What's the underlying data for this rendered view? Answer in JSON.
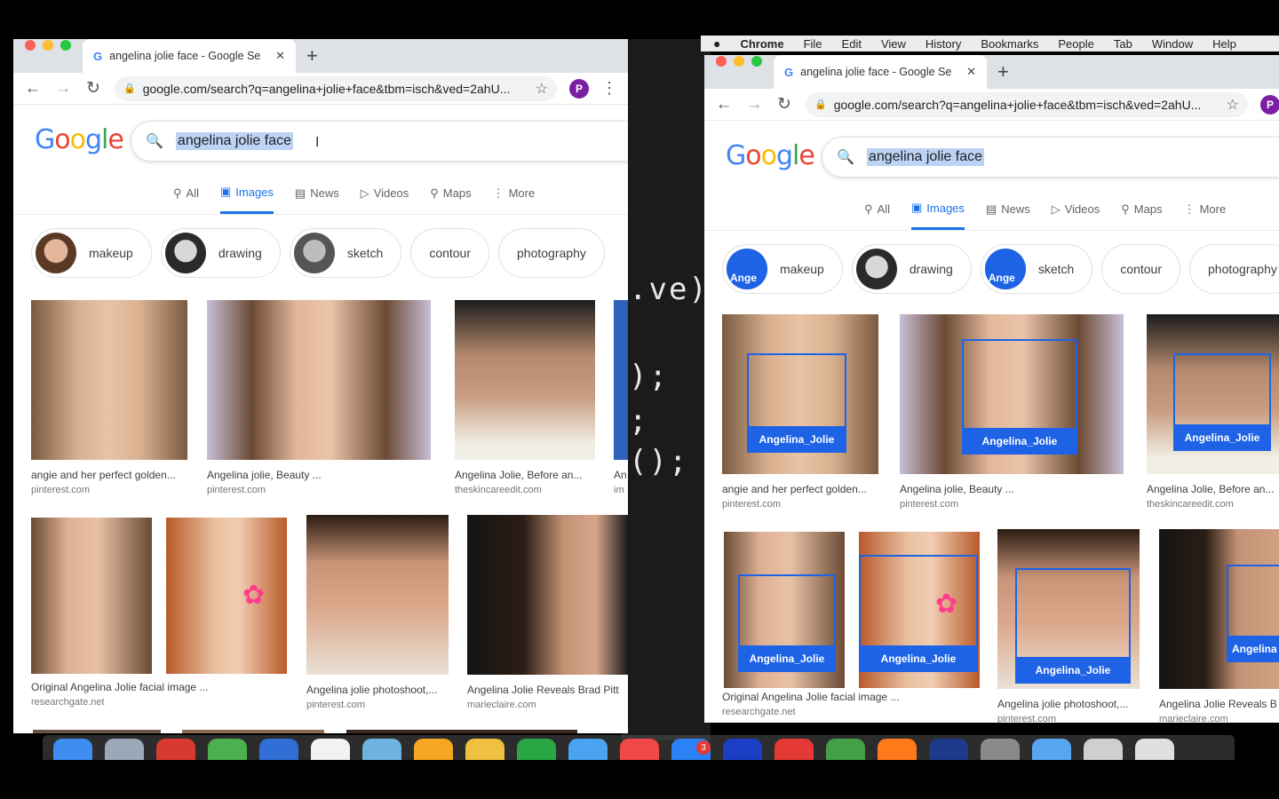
{
  "mac_menubar": {
    "items": [
      "Chrome",
      "File",
      "Edit",
      "View",
      "History",
      "Bookmarks",
      "People",
      "Tab",
      "Window",
      "Help"
    ]
  },
  "editor": {
    "lines": [
      ".ve)",
      ");",
      ";",
      "();"
    ]
  },
  "left": {
    "tab_title": "angelina jolie face - Google Se",
    "url": "google.com/search?q=angelina+jolie+face&tbm=isch&ved=2ahU...",
    "avatar_letter": "P",
    "query": "angelina jolie face",
    "nav_tabs": [
      {
        "label": "All",
        "icon": "search-icon"
      },
      {
        "label": "Images",
        "icon": "image-icon"
      },
      {
        "label": "News",
        "icon": "news-icon"
      },
      {
        "label": "Videos",
        "icon": "video-icon"
      },
      {
        "label": "Maps",
        "icon": "map-pin-icon"
      },
      {
        "label": "More",
        "icon": "more-icon"
      }
    ],
    "chips": [
      "makeup",
      "drawing",
      "sketch",
      "contour",
      "photography"
    ],
    "results": [
      {
        "caption": "angie and her perfect golden...",
        "source": "pinterest.com"
      },
      {
        "caption": "Angelina jolie, Beauty ...",
        "source": "pinterest.com"
      },
      {
        "caption": "Angelina Jolie, Before an...",
        "source": "theskincareedit.com"
      },
      {
        "caption": "An",
        "source": "im"
      },
      {
        "caption": "Original Angelina Jolie facial image ...",
        "source": "researchgate.net"
      },
      {
        "caption": "Angelina jolie photoshoot,...",
        "source": "pinterest.com"
      },
      {
        "caption": "Angelina Jolie Reveals Brad Pitt",
        "source": "marieclaire.com"
      }
    ]
  },
  "right": {
    "tab_title": "angelina jolie face - Google Se",
    "url": "google.com/search?q=angelina+jolie+face&tbm=isch&ved=2ahU...",
    "avatar_letter": "P",
    "query": "angelina jolie face",
    "chips": [
      "makeup",
      "drawing",
      "sketch",
      "contour",
      "photography"
    ],
    "chip_mask_label": "Ange",
    "face_label": "Angelina_Jolie",
    "face_label_cut": "Angelina",
    "results": [
      {
        "caption": "angie and her perfect golden...",
        "source": "pinterest.com"
      },
      {
        "caption": "Angelina jolie, Beauty ...",
        "source": "pinterest.com"
      },
      {
        "caption": "Angelina Jolie, Before an...",
        "source": "theskincareedit.com"
      },
      {
        "caption": "Original Angelina Jolie facial image ...",
        "source": "researchgate.net"
      },
      {
        "caption": "Angelina jolie photoshoot,...",
        "source": "pinterest.com"
      },
      {
        "caption": "Angelina Jolie Reveals B",
        "source": "marieclaire.com"
      }
    ]
  },
  "dock": {
    "badge": "3"
  },
  "colors": {
    "accent": "#1a73e8",
    "face_box": "#1e63e6",
    "avatar": "#7b1fa2"
  }
}
